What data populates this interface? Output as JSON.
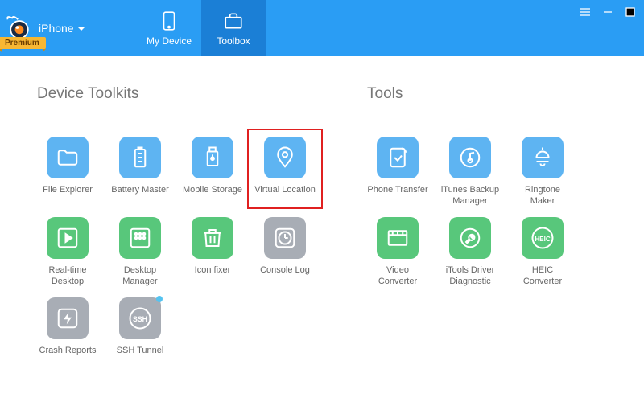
{
  "header": {
    "device_label": "iPhone",
    "premium": "Premium",
    "tabs": {
      "my_device": "My Device",
      "toolbox": "Toolbox"
    },
    "window_controls": {
      "menu": "menu",
      "minimize": "minimize",
      "close": "close"
    }
  },
  "sections": {
    "device_toolkits_title": "Device Toolkits",
    "tools_title": "Tools"
  },
  "device_toolkits": [
    {
      "key": "file_explorer",
      "label": "File Explorer",
      "color": "blue",
      "icon": "folder"
    },
    {
      "key": "battery_master",
      "label": "Battery Master",
      "color": "blue",
      "icon": "battery"
    },
    {
      "key": "mobile_storage",
      "label": "Mobile Storage",
      "color": "blue",
      "icon": "usb"
    },
    {
      "key": "virtual_location",
      "label": "Virtual Location",
      "color": "blue",
      "icon": "pin",
      "highlighted": true
    },
    {
      "key": "realtime_desktop",
      "label": "Real-time Desktop",
      "color": "green",
      "icon": "play"
    },
    {
      "key": "desktop_manager",
      "label": "Desktop Manager",
      "color": "green",
      "icon": "grid"
    },
    {
      "key": "icon_fixer",
      "label": "Icon fixer",
      "color": "green",
      "icon": "trash"
    },
    {
      "key": "console_log",
      "label": "Console Log",
      "color": "gray",
      "icon": "clock"
    },
    {
      "key": "crash_reports",
      "label": "Crash Reports",
      "color": "gray",
      "icon": "flash"
    },
    {
      "key": "ssh_tunnel",
      "label": "SSH Tunnel",
      "color": "gray",
      "icon": "ssh",
      "badge": true
    }
  ],
  "tools": [
    {
      "key": "phone_transfer",
      "label": "Phone Transfer",
      "color": "blue",
      "icon": "transfer"
    },
    {
      "key": "itunes_backup",
      "label": "iTunes Backup Manager",
      "color": "blue",
      "icon": "itunes"
    },
    {
      "key": "ringtone_maker",
      "label": "Ringtone Maker",
      "color": "blue",
      "icon": "bell"
    },
    {
      "key": "video_converter",
      "label": "Video Converter",
      "color": "green",
      "icon": "video"
    },
    {
      "key": "driver_diag",
      "label": "iTools Driver Diagnostic",
      "color": "green",
      "icon": "wrench"
    },
    {
      "key": "heic_converter",
      "label": "HEIC Converter",
      "color": "green",
      "icon": "heic"
    }
  ],
  "colors": {
    "brand": "#2a9df4",
    "brand_active": "#1b7fd6",
    "blue_tile": "#5eb4f2",
    "green_tile": "#58c77b",
    "gray_tile": "#a8adb5",
    "highlight": "#e02020"
  }
}
